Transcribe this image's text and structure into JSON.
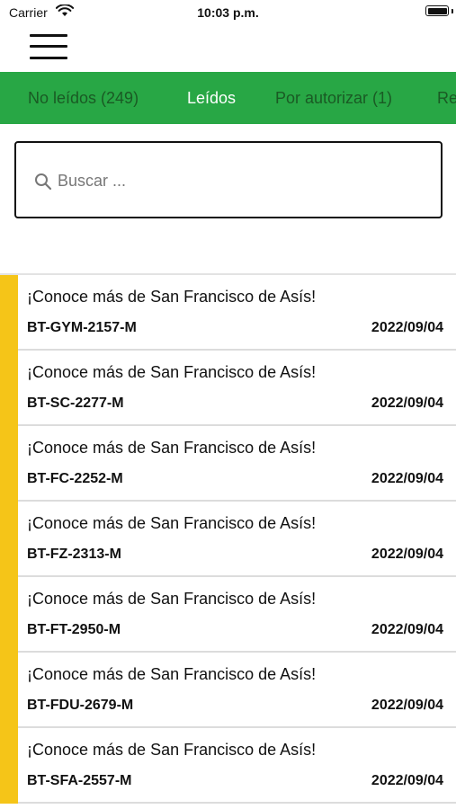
{
  "status_bar": {
    "carrier": "Carrier",
    "time": "10:03 p.m."
  },
  "menu": {
    "icon": "hamburger-menu-icon"
  },
  "tabs": [
    {
      "label": "No leídos (249)",
      "active": false
    },
    {
      "label": "Leídos",
      "active": true
    },
    {
      "label": "Por autorizar (1)",
      "active": false
    },
    {
      "label": "Re",
      "active": false
    }
  ],
  "colors": {
    "tabbar_bg": "#28a745",
    "active_tab": "#ffffff",
    "inactive_tab": "#1a5a24",
    "accent_bar": "#f5c518"
  },
  "search": {
    "placeholder": "Buscar ...",
    "value": "",
    "icon": "search-icon"
  },
  "messages": [
    {
      "title": "¡Conoce más de San Francisco de Asís!",
      "code": "BT-GYM-2157-M",
      "date": "2022/09/04"
    },
    {
      "title": "¡Conoce más de San Francisco de Asís!",
      "code": "BT-SC-2277-M",
      "date": "2022/09/04"
    },
    {
      "title": "¡Conoce más de San Francisco de Asís!",
      "code": "BT-FC-2252-M",
      "date": "2022/09/04"
    },
    {
      "title": "¡Conoce más de San Francisco de Asís!",
      "code": "BT-FZ-2313-M",
      "date": "2022/09/04"
    },
    {
      "title": "¡Conoce más de San Francisco de Asís!",
      "code": "BT-FT-2950-M",
      "date": "2022/09/04"
    },
    {
      "title": "¡Conoce más de San Francisco de Asís!",
      "code": "BT-FDU-2679-M",
      "date": "2022/09/04"
    },
    {
      "title": "¡Conoce más de San Francisco de Asís!",
      "code": "BT-SFA-2557-M",
      "date": "2022/09/04"
    }
  ]
}
